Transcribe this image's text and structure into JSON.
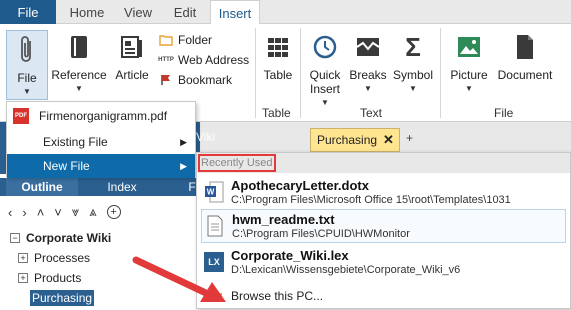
{
  "tabs": {
    "file": "File",
    "items": [
      "Home",
      "View",
      "Edit",
      "Insert"
    ]
  },
  "ribbon": {
    "file_btn": "File",
    "reference_btn": "Reference",
    "article_btn": "Article",
    "folder": "Folder",
    "web_address": "Web Address",
    "bookmark": "Bookmark",
    "table_btn": "Table",
    "table_group": "Table",
    "quick_insert_1": "Quick",
    "quick_insert_2": "Insert",
    "breaks_btn": "Breaks",
    "symbol_btn": "Symbol",
    "text_group": "Text",
    "picture_btn": "Picture",
    "document_btn": "Document",
    "file_group": "File"
  },
  "menu": {
    "items": [
      {
        "label": "Firmenorganigramm.pdf"
      },
      {
        "label": "Existing File"
      },
      {
        "label": "New File"
      }
    ]
  },
  "docbar": {
    "wiki_fragment": "Viki",
    "tab_label": "Purchasing",
    "plus": "+"
  },
  "sidebar": {
    "tabs": [
      "Outline",
      "Index",
      "F"
    ],
    "tree": [
      "Corporate Wiki",
      "Processes",
      "Products",
      "Purchasing"
    ]
  },
  "submenu": {
    "header": "Recently Used",
    "items": [
      {
        "name": "ApothecaryLetter.dotx",
        "path": "C:\\Program Files\\Microsoft Office 15\\root\\Templates\\1031"
      },
      {
        "name": "hwm_readme.txt",
        "path": "C:\\Program Files\\CPUID\\HWMonitor"
      },
      {
        "name": "Corporate_Wiki.lex",
        "path": "D:\\Lexican\\Wissensgebiete\\Corporate_Wiki_v6"
      }
    ],
    "browse": "Browse this PC..."
  },
  "colors": {
    "accent": "#1e5a8c",
    "highlight": "#0e6aa8",
    "annotation_red": "#e23a3a",
    "doc_tab": "#ffe58f"
  }
}
